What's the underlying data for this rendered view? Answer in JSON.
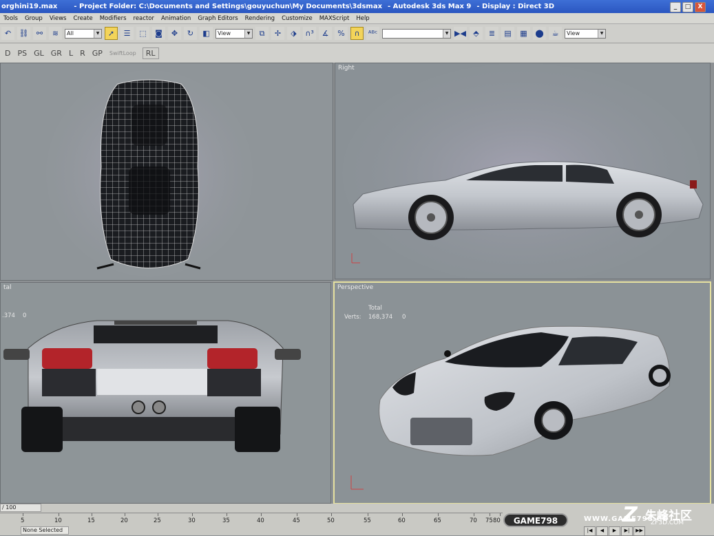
{
  "window": {
    "file_title": "orghini19.max",
    "project_folder": "- Project Folder: C:\\Documents and Settings\\gouyuchun\\My Documents\\3dsmax",
    "app_name": "- Autodesk 3ds Max 9",
    "display_mode": "- Display : Direct 3D",
    "controls": [
      "_",
      "□",
      "X"
    ]
  },
  "menu": [
    "Tools",
    "Group",
    "Views",
    "Create",
    "Modifiers",
    "reactor",
    "Animation",
    "Graph Editors",
    "Rendering",
    "Customize",
    "MAXScript",
    "Help"
  ],
  "toolbar": {
    "selection_filter": "All",
    "reference_coord": "View",
    "named_selection": "",
    "view_dropdown": "View"
  },
  "subtoolbar": [
    "D",
    "PS",
    "GL",
    "GR",
    "L",
    "R",
    "GP"
  ],
  "subtoolbar_swiftloop": "SwiftLoop",
  "subtoolbar_rl": "RL",
  "viewports": {
    "top": {
      "label": ""
    },
    "right": {
      "label": "Right"
    },
    "front": {
      "label": "tal",
      "stats_value": ".374",
      "stats_zero": "0"
    },
    "perspective": {
      "label": "Perspective",
      "total_label": "Total",
      "verts_label": "Verts:",
      "verts_value": "168,374",
      "verts_zero": "0"
    }
  },
  "timeline": {
    "frame_counter": "/ 100",
    "ticks": [
      "5",
      "10",
      "15",
      "20",
      "25",
      "30",
      "35",
      "40",
      "45",
      "50",
      "55",
      "60",
      "65",
      "70",
      "75",
      "80"
    ],
    "status": "None Selected"
  },
  "playback": [
    "|◀",
    "◀",
    "▶",
    "▶|",
    "▶▶"
  ],
  "watermark": {
    "badge": "GAME798",
    "url": "WWW.GAME798.CO",
    "logo": "Z",
    "cn_text": "朱峰社区",
    "site": "ZF3D.COM"
  },
  "colors": {
    "titlebar": "#2a56c0",
    "viewport_bg": "#8d9397",
    "active_viewport_border": "#e6e1a0",
    "car_body": "#c5c8ce"
  }
}
